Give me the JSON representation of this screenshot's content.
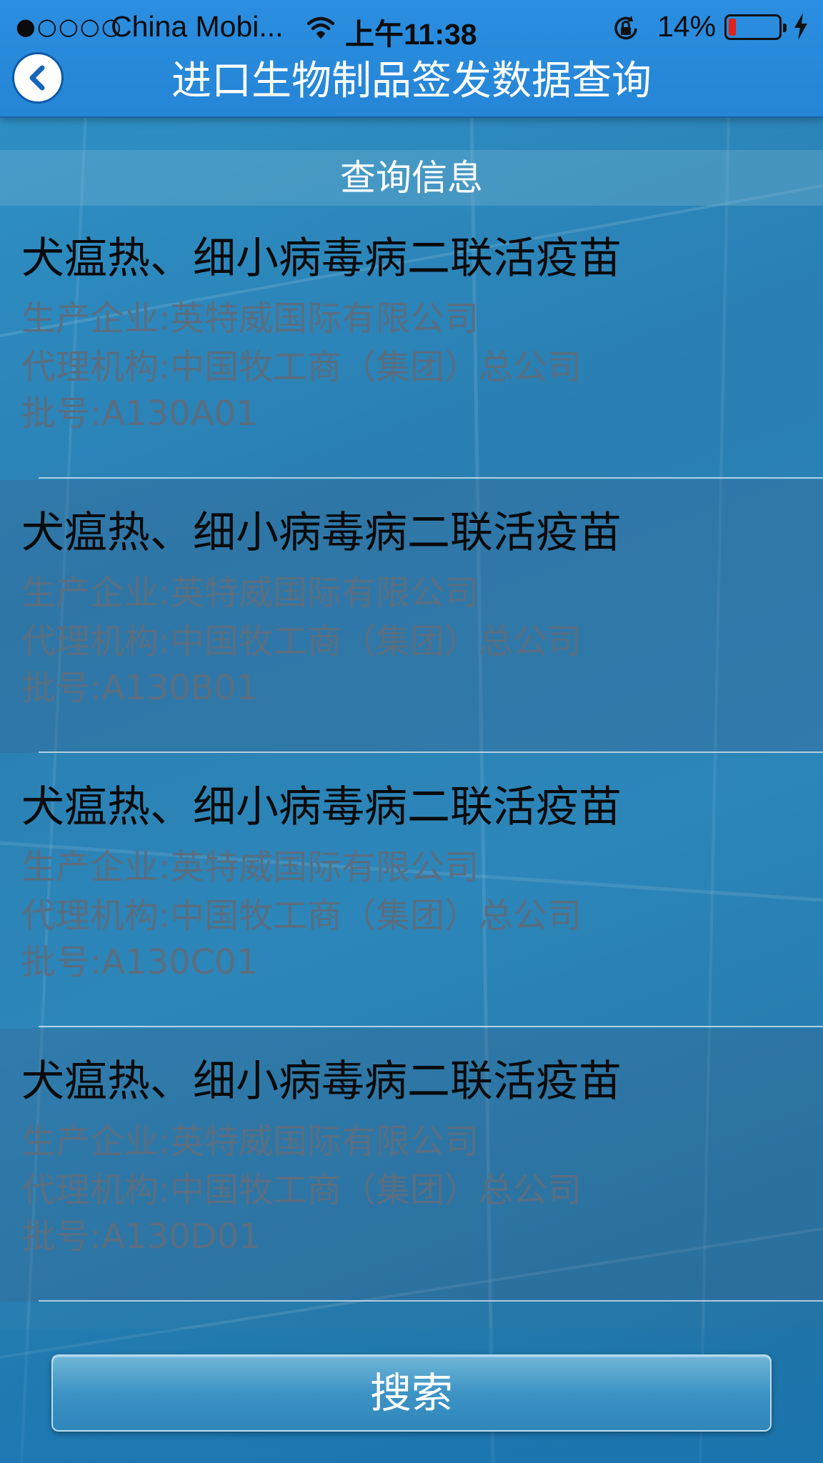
{
  "status_bar": {
    "signal": "●○○○○",
    "carrier": "China Mobi...",
    "time": "上午11:38",
    "battery_percent": "14%",
    "battery_level": 0.14,
    "icons": [
      "wifi-icon",
      "orientation-lock-icon",
      "battery-icon",
      "charging-bolt-icon"
    ]
  },
  "header": {
    "title": "进口生物制品签发数据查询",
    "back_icon": "chevron-left-icon"
  },
  "section": {
    "title": "查询信息"
  },
  "results": [
    {
      "title": "犬瘟热、细小病毒病二联活疫苗",
      "manufacturer": "生产企业:英特威国际有限公司",
      "agency": "代理机构:中国牧工商（集团）总公司",
      "batch": "批号:A130A01"
    },
    {
      "title": "犬瘟热、细小病毒病二联活疫苗",
      "manufacturer": "生产企业:英特威国际有限公司",
      "agency": "代理机构:中国牧工商（集团）总公司",
      "batch": "批号:A130B01"
    },
    {
      "title": "犬瘟热、细小病毒病二联活疫苗",
      "manufacturer": "生产企业:英特威国际有限公司",
      "agency": "代理机构:中国牧工商（集团）总公司",
      "batch": "批号:A130C01"
    },
    {
      "title": "犬瘟热、细小病毒病二联活疫苗",
      "manufacturer": "生产企业:英特威国际有限公司",
      "agency": "代理机构:中国牧工商（集团）总公司",
      "batch": "批号:A130D01"
    }
  ],
  "footer": {
    "search_label": "搜索"
  },
  "colors": {
    "header_blue": "#2585d6",
    "title_text": "#0a0a0a",
    "detail_text": "#5a6e80",
    "battery_low": "#e0231d"
  }
}
